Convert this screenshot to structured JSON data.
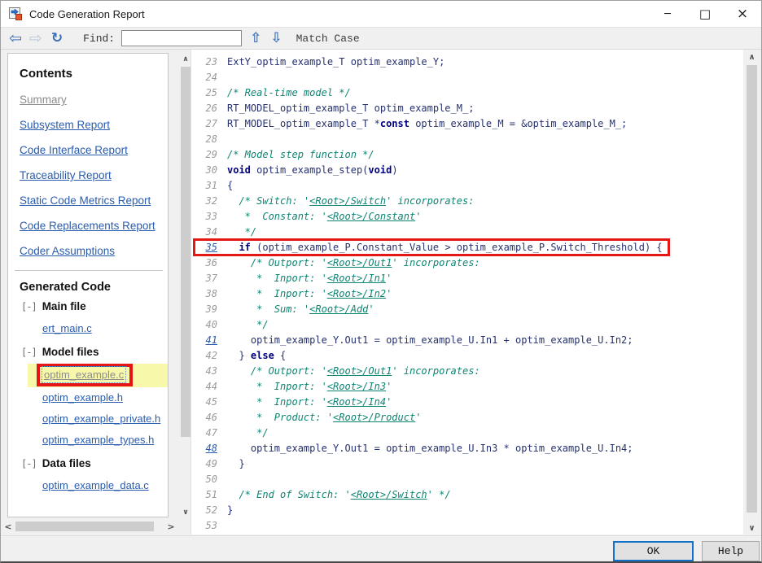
{
  "window": {
    "title": "Code Generation Report",
    "minimize_glyph": "─",
    "maximize_glyph": "□",
    "close_glyph": "×"
  },
  "toolbar": {
    "back_glyph": "⇦",
    "forward_glyph": "⇨",
    "refresh_glyph": "↻",
    "find_label": "Find:",
    "find_value": "",
    "prev_glyph": "⇧",
    "next_glyph": "⇩",
    "match_case_label": "Match Case"
  },
  "icons": {
    "scroll_up": "∧",
    "scroll_down": "∨",
    "scroll_left": "<",
    "scroll_right": ">"
  },
  "sidebar": {
    "contents_title": "Contents",
    "toc_links": [
      {
        "label": "Summary",
        "visited": true
      },
      {
        "label": "Subsystem Report",
        "visited": false
      },
      {
        "label": "Code Interface Report",
        "visited": false
      },
      {
        "label": "Traceability Report",
        "visited": false
      },
      {
        "label": "Static Code Metrics Report",
        "visited": false
      },
      {
        "label": "Code Replacements Report",
        "visited": false
      },
      {
        "label": "Coder Assumptions",
        "visited": false
      }
    ],
    "generated_code_title": "Generated Code",
    "tree": [
      {
        "toggle": "[-]",
        "label": "Main file",
        "files": [
          {
            "name": "ert_main.c",
            "visited": false,
            "selected": false
          }
        ]
      },
      {
        "toggle": "[-]",
        "label": "Model files",
        "files": [
          {
            "name": "optim_example.c",
            "visited": true,
            "selected": true
          },
          {
            "name": "optim_example.h",
            "visited": false,
            "selected": false
          },
          {
            "name": "optim_example_private.h",
            "visited": false,
            "selected": false
          },
          {
            "name": "optim_example_types.h",
            "visited": false,
            "selected": false
          }
        ]
      },
      {
        "toggle": "[-]",
        "label": "Data files",
        "files": [
          {
            "name": "optim_example_data.c",
            "visited": false,
            "selected": false
          }
        ]
      }
    ]
  },
  "code": {
    "lines": [
      {
        "n": "23",
        "link": false,
        "boxed": false,
        "seg": [
          {
            "t": "c",
            "x": "ExtY_optim_example_T optim_example_Y;"
          }
        ]
      },
      {
        "n": "24",
        "link": false,
        "boxed": false,
        "seg": []
      },
      {
        "n": "25",
        "link": false,
        "boxed": false,
        "seg": [
          {
            "t": "m",
            "x": "/* Real-time model */"
          }
        ]
      },
      {
        "n": "26",
        "link": false,
        "boxed": false,
        "seg": [
          {
            "t": "c",
            "x": "RT_MODEL_optim_example_T optim_example_M_;"
          }
        ]
      },
      {
        "n": "27",
        "link": false,
        "boxed": false,
        "seg": [
          {
            "t": "c",
            "x": "RT_MODEL_optim_example_T *"
          },
          {
            "t": "k",
            "x": "const"
          },
          {
            "t": "c",
            "x": " optim_example_M = &optim_example_M_;"
          }
        ]
      },
      {
        "n": "28",
        "link": false,
        "boxed": false,
        "seg": []
      },
      {
        "n": "29",
        "link": false,
        "boxed": false,
        "seg": [
          {
            "t": "m",
            "x": "/* Model step function */"
          }
        ]
      },
      {
        "n": "30",
        "link": false,
        "boxed": false,
        "seg": [
          {
            "t": "k",
            "x": "void"
          },
          {
            "t": "c",
            "x": " optim_example_step("
          },
          {
            "t": "k",
            "x": "void"
          },
          {
            "t": "c",
            "x": ")"
          }
        ]
      },
      {
        "n": "31",
        "link": false,
        "boxed": false,
        "seg": [
          {
            "t": "c",
            "x": "{"
          }
        ]
      },
      {
        "n": "32",
        "link": false,
        "boxed": false,
        "seg": [
          {
            "t": "m",
            "x": "  /* Switch: '"
          },
          {
            "t": "l",
            "x": "<Root>/Switch"
          },
          {
            "t": "m",
            "x": "' incorporates:"
          }
        ]
      },
      {
        "n": "33",
        "link": false,
        "boxed": false,
        "seg": [
          {
            "t": "m",
            "x": "   *  Constant: '"
          },
          {
            "t": "l",
            "x": "<Root>/Constant"
          },
          {
            "t": "m",
            "x": "'"
          }
        ]
      },
      {
        "n": "34",
        "link": false,
        "boxed": false,
        "seg": [
          {
            "t": "m",
            "x": "   */"
          }
        ]
      },
      {
        "n": "35",
        "link": true,
        "boxed": true,
        "seg": [
          {
            "t": "c",
            "x": "  "
          },
          {
            "t": "k",
            "x": "if"
          },
          {
            "t": "c",
            "x": " (optim_example_P.Constant_Value > optim_example_P.Switch_Threshold) {"
          }
        ]
      },
      {
        "n": "36",
        "link": false,
        "boxed": false,
        "seg": [
          {
            "t": "m",
            "x": "    /* Outport: '"
          },
          {
            "t": "l",
            "x": "<Root>/Out1"
          },
          {
            "t": "m",
            "x": "' incorporates:"
          }
        ]
      },
      {
        "n": "37",
        "link": false,
        "boxed": false,
        "seg": [
          {
            "t": "m",
            "x": "     *  Inport: '"
          },
          {
            "t": "l",
            "x": "<Root>/In1"
          },
          {
            "t": "m",
            "x": "'"
          }
        ]
      },
      {
        "n": "38",
        "link": false,
        "boxed": false,
        "seg": [
          {
            "t": "m",
            "x": "     *  Inport: '"
          },
          {
            "t": "l",
            "x": "<Root>/In2"
          },
          {
            "t": "m",
            "x": "'"
          }
        ]
      },
      {
        "n": "39",
        "link": false,
        "boxed": false,
        "seg": [
          {
            "t": "m",
            "x": "     *  Sum: '"
          },
          {
            "t": "l",
            "x": "<Root>/Add"
          },
          {
            "t": "m",
            "x": "'"
          }
        ]
      },
      {
        "n": "40",
        "link": false,
        "boxed": false,
        "seg": [
          {
            "t": "m",
            "x": "     */"
          }
        ]
      },
      {
        "n": "41",
        "link": true,
        "boxed": false,
        "seg": [
          {
            "t": "c",
            "x": "    optim_example_Y.Out1 = optim_example_U.In1 + optim_example_U.In2;"
          }
        ]
      },
      {
        "n": "42",
        "link": false,
        "boxed": false,
        "seg": [
          {
            "t": "c",
            "x": "  } "
          },
          {
            "t": "k",
            "x": "else"
          },
          {
            "t": "c",
            "x": " {"
          }
        ]
      },
      {
        "n": "43",
        "link": false,
        "boxed": false,
        "seg": [
          {
            "t": "m",
            "x": "    /* Outport: '"
          },
          {
            "t": "l",
            "x": "<Root>/Out1"
          },
          {
            "t": "m",
            "x": "' incorporates:"
          }
        ]
      },
      {
        "n": "44",
        "link": false,
        "boxed": false,
        "seg": [
          {
            "t": "m",
            "x": "     *  Inport: '"
          },
          {
            "t": "l",
            "x": "<Root>/In3"
          },
          {
            "t": "m",
            "x": "'"
          }
        ]
      },
      {
        "n": "45",
        "link": false,
        "boxed": false,
        "seg": [
          {
            "t": "m",
            "x": "     *  Inport: '"
          },
          {
            "t": "l",
            "x": "<Root>/In4"
          },
          {
            "t": "m",
            "x": "'"
          }
        ]
      },
      {
        "n": "46",
        "link": false,
        "boxed": false,
        "seg": [
          {
            "t": "m",
            "x": "     *  Product: '"
          },
          {
            "t": "l",
            "x": "<Root>/Product"
          },
          {
            "t": "m",
            "x": "'"
          }
        ]
      },
      {
        "n": "47",
        "link": false,
        "boxed": false,
        "seg": [
          {
            "t": "m",
            "x": "     */"
          }
        ]
      },
      {
        "n": "48",
        "link": true,
        "boxed": false,
        "seg": [
          {
            "t": "c",
            "x": "    optim_example_Y.Out1 = optim_example_U.In3 * optim_example_U.In4;"
          }
        ]
      },
      {
        "n": "49",
        "link": false,
        "boxed": false,
        "seg": [
          {
            "t": "c",
            "x": "  }"
          }
        ]
      },
      {
        "n": "50",
        "link": false,
        "boxed": false,
        "seg": []
      },
      {
        "n": "51",
        "link": false,
        "boxed": false,
        "seg": [
          {
            "t": "m",
            "x": "  /* End of Switch: '"
          },
          {
            "t": "l",
            "x": "<Root>/Switch"
          },
          {
            "t": "m",
            "x": "' */"
          }
        ]
      },
      {
        "n": "52",
        "link": false,
        "boxed": false,
        "seg": [
          {
            "t": "c",
            "x": "}"
          }
        ]
      },
      {
        "n": "53",
        "link": false,
        "boxed": false,
        "seg": []
      }
    ]
  },
  "footer": {
    "ok_label": "OK",
    "help_label": "Help"
  },
  "colors": {
    "link_blue": "#2a5cad",
    "visited_gray": "#8c8c8c",
    "comment_teal": "#0e8573",
    "keyword_navy": "#000080",
    "code_navy": "#26316e",
    "annotation_red": "#e51616",
    "highlight_yellow": "#f8f8aa",
    "ok_button_border": "#1270c9"
  }
}
